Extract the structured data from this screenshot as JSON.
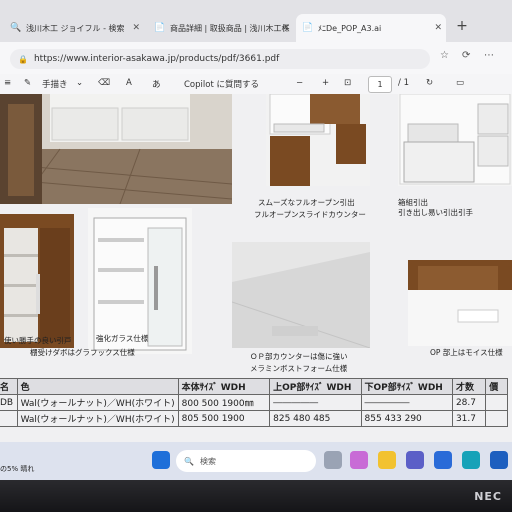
{
  "tabs": [
    {
      "label": "浅川木工 ジョイフル - 検索",
      "icon": "search-favicon"
    },
    {
      "label": "商品詳細 | 取扱商品 | 浅川木工株",
      "icon": "page-favicon"
    },
    {
      "label": "ﾒﾆDe_POP_A3.ai",
      "icon": "pdf-favicon"
    }
  ],
  "address": {
    "url": "https://www.interior-asakawa.jp/products/pdf/3661.pdf"
  },
  "pdf_toolbar": {
    "draw_label": "手描き",
    "read_aloud_label": "A",
    "copilot_label": "Copilot に質問する",
    "zoom_minus": "−",
    "zoom_plus": "+",
    "page_current": "1",
    "page_total": "/ 1"
  },
  "captions": {
    "top_center_1": "スムーズなフルオープン引出",
    "top_center_2": "フルオープンスライドカウンター",
    "top_right_1": "箱組引出",
    "top_right_2": "引き出し易い引出引手",
    "mid_left_1": "使い勝手の良い引戸",
    "mid_left_2": "棚受けダボはグラフックス仕様",
    "mid_center_left": "強化ガラス仕様",
    "mid_center_1": "ＯＰ部カウンターは傷に強い",
    "mid_center_2": "メラミンボストフォーム仕様",
    "mid_right": "OP 部上はモイス仕様"
  },
  "spec_table": {
    "headers": [
      "名",
      "色",
      "本体ｻｲｽﾞ WDH",
      "上OP部ｻｲｽﾞ WDH",
      "下OP部ｻｲｽﾞ WDH",
      "才数",
      "價"
    ],
    "rows": [
      [
        "DB",
        "Wal(ウォールナット)／WH(ホワイト)",
        "800 500 1900㎜",
        "―――――",
        "―――――",
        "28.7",
        ""
      ],
      [
        "",
        "Wal(ウォールナット)／WH(ホワイト)",
        "805 500 1900",
        "825 480 485",
        "855 433 290",
        "31.7",
        ""
      ]
    ]
  },
  "taskbar": {
    "weather": "の5% 晴れ",
    "search_placeholder": "検索"
  },
  "bezel": {
    "brand": "NEC"
  },
  "colors": {
    "walnut": "#7a4a22",
    "white_cabinet": "#f4f4f4",
    "taskbar": "#dde2ee"
  }
}
